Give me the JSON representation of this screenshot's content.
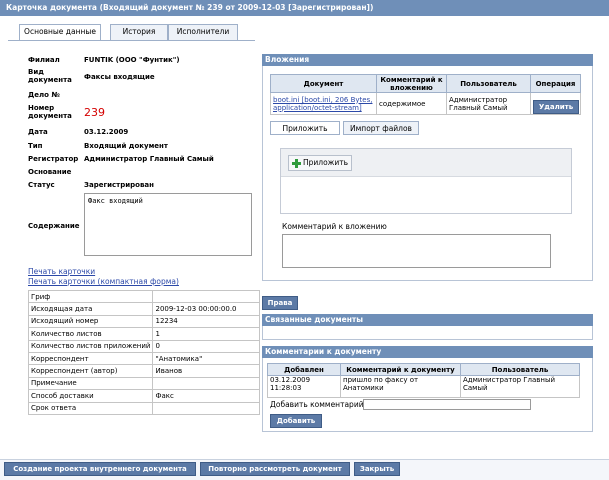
{
  "window": {
    "title": "Карточка документа (Входящий документ № 239 от 2009-12-03 [Зарегистрирован])"
  },
  "tabs": [
    {
      "label": "Основные данные",
      "active": true
    },
    {
      "label": "История",
      "active": false
    },
    {
      "label": "Исполнители",
      "active": false
    }
  ],
  "fields": {
    "branch_label": "Филиал",
    "branch_value": "FUNTIK (ООО \"Фунтик\")",
    "doctype_label1": "Вид",
    "doctype_label2": "документа",
    "doctype_value": "Факсы входящие",
    "case_label": "Дело №",
    "num_label1": "Номер",
    "num_label2": "документа",
    "num_value": "239",
    "date_label": "Дата",
    "date_value": "03.12.2009",
    "type_label": "Тип",
    "type_value": "Входящий документ",
    "registrar_label": "Регистратор",
    "registrar_value": "Администратор Главный Самый",
    "basis_label": "Основание",
    "status_label": "Статус",
    "status_value": "Зарегистрирован",
    "content_label": "Содержание",
    "content_value": "Факс входящий"
  },
  "links": {
    "print_card": "Печать карточки",
    "print_card_compact": "Печать карточки (компактная форма)"
  },
  "props": [
    {
      "k": "Гриф",
      "v": ""
    },
    {
      "k": "Исходящая дата",
      "v": "2009-12-03 00:00:00.0"
    },
    {
      "k": "Исходящий номер",
      "v": "12234"
    },
    {
      "k": "Количество листов",
      "v": "1"
    },
    {
      "k": "Количество листов приложений",
      "v": "0"
    },
    {
      "k": "Корреспондент",
      "v": "\"Анатомика\""
    },
    {
      "k": "Корреспондент (автор)",
      "v": "Иванов"
    },
    {
      "k": "Примечание",
      "v": ""
    },
    {
      "k": "Способ доставки",
      "v": "Факс"
    },
    {
      "k": "Срок ответа",
      "v": ""
    }
  ],
  "attachments": {
    "title": "Вложения",
    "col_doc": "Документ",
    "col_comment1": "Комментарий к",
    "col_comment2": "вложению",
    "col_user": "Пользователь",
    "col_op": "Операция",
    "row_doc1": "boot.ini [boot.ini, 206 Bytes,",
    "row_doc2": "application/octet-stream]",
    "row_comment": "содержимое",
    "row_user1": "Администратор",
    "row_user2": "Главный Самый",
    "delete_label": "Удалить",
    "subtab_attach": "Приложить",
    "subtab_import": "Импорт файлов",
    "add_label": "Приложить",
    "comment_label": "Комментарий к вложению"
  },
  "rights_label": "Права",
  "linked": {
    "title": "Связанные документы"
  },
  "comments": {
    "title": "Комментарии к документу",
    "col_added": "Добавлен",
    "col_comment": "Комментарий к документу",
    "col_user": "Пользователь",
    "row_date1": "03.12.2009",
    "row_date2": "11:28:03",
    "row_text1": "пришло по факсу от",
    "row_text2": "Анатомики",
    "row_user1": "Администратор Главный",
    "row_user2": "Самый",
    "add_label": "Добавить комментарий",
    "add_button": "Добавить"
  },
  "bottom": {
    "create_internal": "Создание проекта внутреннего документа",
    "review_again": "Повторно рассмотреть документ",
    "close": "Закрыть"
  },
  "colors": {
    "header": "#6f8fb8",
    "button": "#5c7aa6",
    "doc_num": "#d40000",
    "link": "#2c49a8"
  }
}
